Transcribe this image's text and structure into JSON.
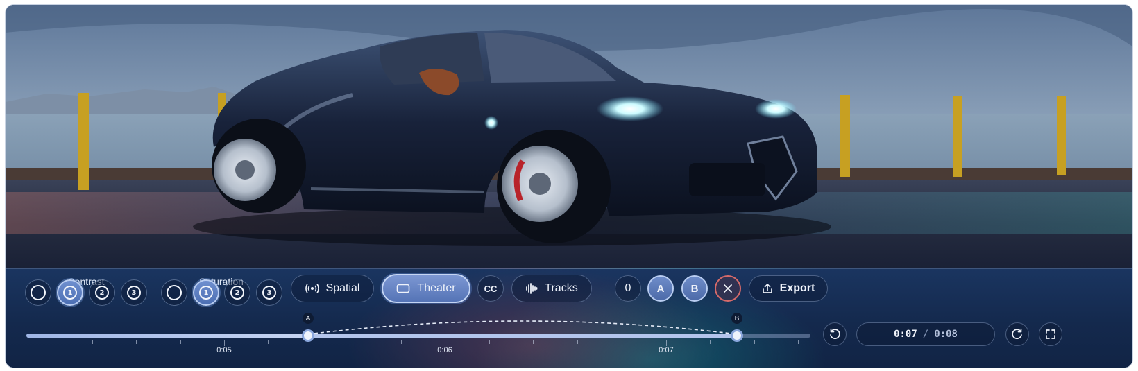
{
  "video": {
    "subject": "car-scene"
  },
  "controls": {
    "contrast": {
      "title": "Contrast",
      "options": [
        "",
        "1",
        "2",
        "3"
      ],
      "selected": 1
    },
    "saturation": {
      "title": "Saturation",
      "options": [
        "",
        "1",
        "2",
        "3"
      ],
      "selected": 1
    },
    "spatial_label": "Spatial",
    "theater_label": "Theater",
    "cc_label": "CC",
    "tracks_label": "Tracks",
    "counter_value": "0",
    "a_label": "A",
    "b_label": "B",
    "export_label": "Export"
  },
  "timeline": {
    "ticks": [
      "0:05",
      "0:06",
      "0:07"
    ],
    "marker_a": "A",
    "marker_b": "B",
    "current_time": "0:07",
    "separator": "/",
    "duration": "0:08"
  },
  "icons": {
    "spatial": "broadcast-icon",
    "theater": "theater-rect-icon",
    "tracks": "waveform-icon",
    "clear": "close-icon",
    "export": "upload-icon",
    "rewind": "rotate-left-icon",
    "forward": "rotate-right-icon",
    "fullscreen": "fullscreen-icon"
  },
  "colors": {
    "accent": "#5574b6",
    "clear_ring": "#d66a6a"
  }
}
